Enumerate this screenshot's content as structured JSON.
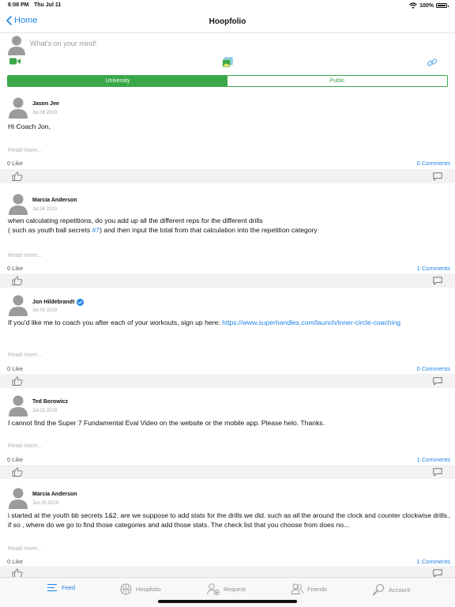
{
  "status_bar": {
    "time": "6:08 PM",
    "date": "Thu Jul 11",
    "battery": "100%"
  },
  "nav": {
    "back_label": "Home",
    "title": "Hoopfolio"
  },
  "composer": {
    "placeholder": "What's on your mind!"
  },
  "segments": [
    {
      "label": "University",
      "active": true
    },
    {
      "label": "Public",
      "active": false
    }
  ],
  "colors": {
    "accent": "#1f83e6",
    "segment_green": "#3aa84a",
    "action_bar": "#f2f2f2"
  },
  "posts": [
    {
      "author": "Jason Jee",
      "date": "Jul 08 2019",
      "body": "Hi Coach Jon,",
      "read_more": "Read more...",
      "likes": "0 Like",
      "comments": "0 Comments"
    },
    {
      "author": "Marcia Anderson",
      "date": "Jul 04 2019",
      "body_line1": "when calculating repetitions, do you add up all the different reps for the different drills",
      "body_line2_pre": "( such as youth ball secrets ",
      "body_line2_link": "#7",
      "body_line2_post": ") and then input the total from that calculation into the repetition category",
      "read_more": "Read more...",
      "likes": "0 Like",
      "comments": "1 Comments"
    },
    {
      "author": "Jon Hildebrandt",
      "verified": true,
      "date": "Jul 03 2019",
      "body_pre": "If you'd like me to coach you after each of your workouts, sign up here: ",
      "body_link": "https://www.superhandles.com/launch/inner-circle-coaching",
      "read_more": "Read more...",
      "likes": "0 Like",
      "comments": "0 Comments"
    },
    {
      "author": "Ted Borowicz",
      "date": "Jul 02 2019",
      "body": "I cannot find the Super 7 Fundamental Eval Video on the website or the mobile app. Please helo. Thanks.",
      "read_more": "Read more...",
      "likes": "0 Like",
      "comments": "1 Comments"
    },
    {
      "author": "Marcia Anderson",
      "date": "Jun 25 2019",
      "body": "i started at the youth bb secrets 1&2. are we suppose to add stats for the drills we did. such as all the around the clock and counter clockwise drills.. if so , where do we go to find those categories and add those stats. The check list that you choose from does no...",
      "read_more": "Read more...",
      "likes": "0 Like",
      "comments": "1 Comments"
    }
  ],
  "tabs": [
    {
      "label": "Feed",
      "icon": "feed-icon",
      "active": true
    },
    {
      "label": "Hoopfolio",
      "icon": "basketball-icon",
      "active": false
    },
    {
      "label": "Request",
      "icon": "add-person-icon",
      "active": false
    },
    {
      "label": "Friends",
      "icon": "friends-icon",
      "active": false
    },
    {
      "label": "Account",
      "icon": "account-search-icon",
      "active": false
    }
  ]
}
